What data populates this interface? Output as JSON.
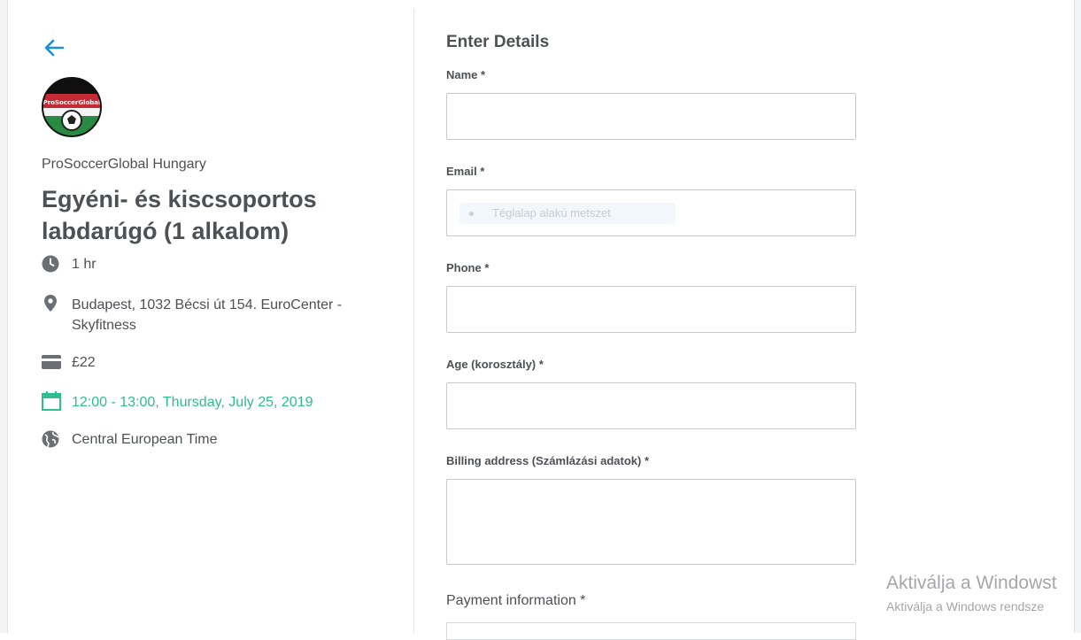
{
  "event": {
    "organizer": "ProSoccerGlobal Hungary",
    "title": "Egyéni- és kiscsoportos labdarúgó (1 alkalom)",
    "duration": "1 hr",
    "location": "Budapest, 1032 Bécsi út 154. EuroCenter - Skyfitness",
    "price": "£22",
    "datetime": "12:00 - 13:00, Thursday, July 25, 2019",
    "timezone": "Central European Time",
    "accent_color": "#2ebd91",
    "back_icon_color": "#1a8fe0"
  },
  "form": {
    "heading": "Enter Details",
    "fields": [
      {
        "label": "Name *",
        "value": ""
      },
      {
        "label": "Email *",
        "value": "",
        "autofill_suggestion": "Téglalap alakú metszet"
      },
      {
        "label": "Phone *",
        "value": ""
      },
      {
        "label": "Age (korosztály) *",
        "value": ""
      },
      {
        "label": "Billing address (Számlázási adatok) *",
        "value": ""
      }
    ],
    "payment_label": "Payment information *"
  },
  "watermark": {
    "line1": "Aktiválja a Windowst",
    "line2": "Aktiválja a Windows rendsze"
  }
}
